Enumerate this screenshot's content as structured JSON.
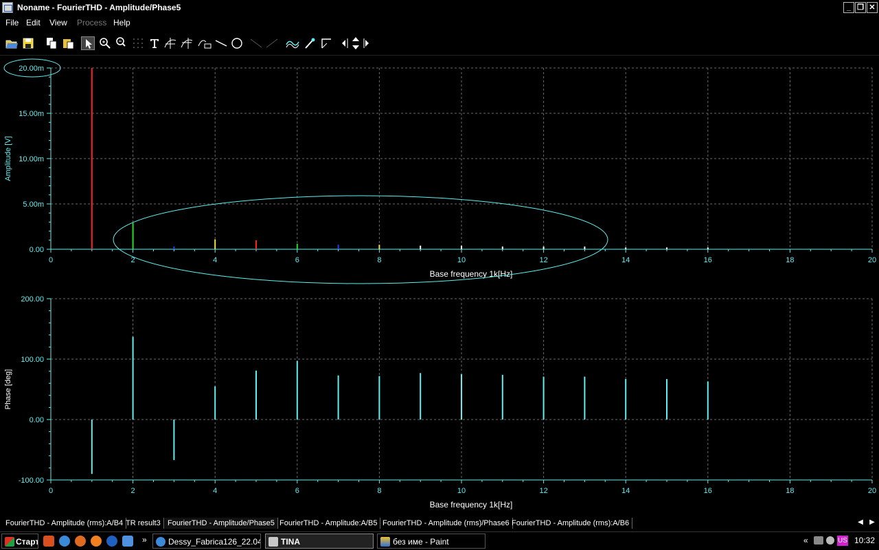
{
  "window": {
    "title": "Noname - FourierTHD - Amplitude/Phase5",
    "buttons": {
      "minimize": "_",
      "restore": "❐",
      "close": "✕"
    }
  },
  "menu": {
    "items": [
      "File",
      "Edit",
      "View",
      "Process",
      "Help"
    ],
    "disabled": [
      "Process"
    ]
  },
  "toolbar": {
    "icons": [
      "open-icon",
      "save-icon",
      "copy-icon",
      "paste-icon",
      "pointer-icon",
      "zoom-in-icon",
      "zoom-100-icon",
      "grid-icon",
      "text-icon",
      "cursor-a-icon",
      "cursor-b-icon",
      "curve-label-icon",
      "line-icon",
      "circle-icon",
      "draw-line-1-icon",
      "draw-line-2-icon",
      "curve-icon",
      "pick-icon",
      "axis-icon",
      "arrow-left-icon",
      "arrow-updown-icon",
      "arrow-right-icon"
    ]
  },
  "colors": {
    "cyan": "#5ef0f0",
    "grid": "#6a6a6a",
    "red": "#ff2020",
    "green": "#20e020",
    "blue": "#2040ff",
    "yellow": "#f0e040",
    "white": "#ffffff"
  },
  "chart_data": [
    {
      "type": "bar",
      "ylabel": "Amplitude [V]",
      "xlabel": "Base frequency 1k[Hz]",
      "xlim": [
        0,
        20
      ],
      "ylim": [
        0,
        0.02
      ],
      "x_ticks": [
        "0",
        "2",
        "4",
        "6",
        "8",
        "10",
        "12",
        "14",
        "16",
        "18",
        "20"
      ],
      "y_ticks": [
        "0.00",
        "5.00m",
        "10.00m",
        "15.00m",
        "20.00m"
      ],
      "grid": true,
      "x": [
        1,
        2,
        3,
        4,
        5,
        6,
        7,
        8,
        9,
        10,
        11,
        12,
        13,
        14,
        15,
        16
      ],
      "values": [
        0.02,
        0.0029,
        0.0003,
        0.0011,
        0.001,
        0.0006,
        0.0005,
        0.0005,
        0.0004,
        0.0004,
        0.0003,
        0.0003,
        0.0003,
        0.0002,
        0.0002,
        0.0002
      ],
      "bar_colors": [
        "#ff2020",
        "#20e020",
        "#2040ff",
        "#f0e040",
        "#ff2020",
        "#20e020",
        "#2040ff",
        "#f0e040",
        "#ffffff",
        "#ffffff",
        "#ffffff",
        "#ffffff",
        "#ffffff",
        "#ffffff",
        "#ffffff",
        "#ffffff"
      ]
    },
    {
      "type": "bar",
      "ylabel": "Phase [deg]",
      "xlabel": "Base frequency 1k[Hz]",
      "xlim": [
        0,
        20
      ],
      "ylim": [
        -100,
        200
      ],
      "x_ticks": [
        "0",
        "2",
        "4",
        "6",
        "8",
        "10",
        "12",
        "14",
        "16",
        "18",
        "20"
      ],
      "y_ticks": [
        "-100.00",
        "0.00",
        "100.00",
        "200.00"
      ],
      "grid": true,
      "x": [
        1,
        2,
        3,
        4,
        5,
        6,
        7,
        8,
        9,
        10,
        11,
        12,
        13,
        14,
        15,
        16
      ],
      "values": [
        -90,
        137,
        -67,
        55,
        81,
        97,
        73,
        72,
        77,
        75,
        74,
        71,
        71,
        67,
        67,
        63
      ]
    }
  ],
  "tabs": {
    "items": [
      "FourierTHD - Amplitude (rms):A/B4",
      "TR result3",
      "FourierTHD - Amplitude/Phase5",
      "FourierTHD - Amplitude:A/B5",
      "FourierTHD - Amplitude (rms)/Phase6",
      "FourierTHD - Amplitude (rms):A/B6"
    ],
    "active": 2
  },
  "taskbar": {
    "start": "Старт",
    "tasks": [
      "Dessy_Fabrica126_22.04...",
      "TINA",
      "без име - Paint"
    ],
    "active_task": 1,
    "tray_lang": "US",
    "clock": "10:32",
    "chevron": "«",
    "more": "»"
  }
}
